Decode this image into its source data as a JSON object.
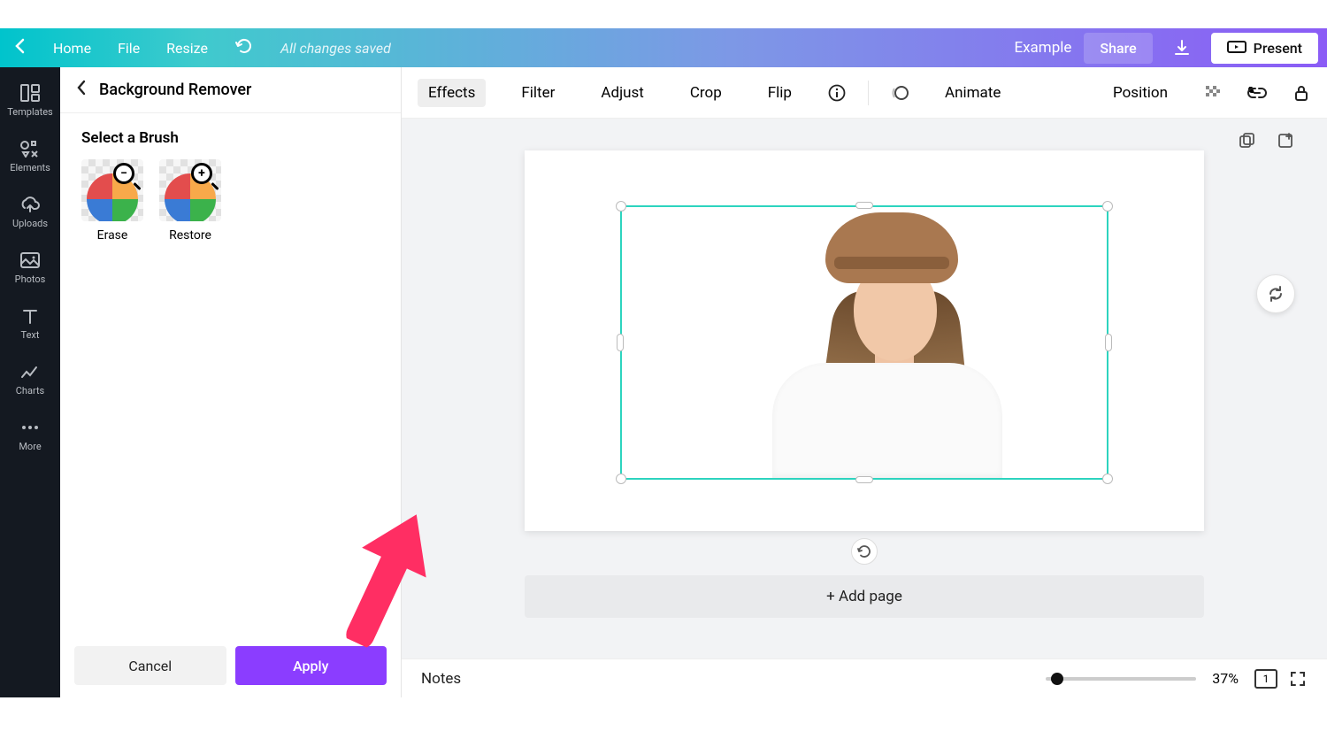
{
  "topbar": {
    "home": "Home",
    "file": "File",
    "resize": "Resize",
    "saved": "All changes saved",
    "example": "Example",
    "share": "Share",
    "present": "Present"
  },
  "leftrail": {
    "templates": "Templates",
    "elements": "Elements",
    "uploads": "Uploads",
    "photos": "Photos",
    "text": "Text",
    "charts": "Charts",
    "more": "More"
  },
  "sidepanel": {
    "title": "Background Remover",
    "brush_heading": "Select a Brush",
    "erase": "Erase",
    "restore": "Restore",
    "cancel": "Cancel",
    "apply": "Apply"
  },
  "toolbar": {
    "effects": "Effects",
    "filter": "Filter",
    "adjust": "Adjust",
    "crop": "Crop",
    "flip": "Flip",
    "animate": "Animate",
    "position": "Position"
  },
  "canvas": {
    "add_page": "+ Add page"
  },
  "bottombar": {
    "notes": "Notes",
    "zoom_pct": "37%",
    "page_count": "1"
  },
  "annotation": {
    "kind": "pointer-arrow",
    "target": "apply-button"
  }
}
